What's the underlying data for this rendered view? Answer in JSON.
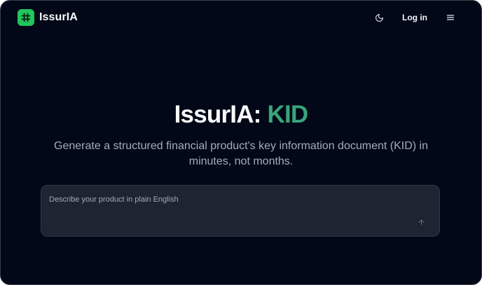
{
  "header": {
    "brand": "IssurIA",
    "login_label": "Log in",
    "theme_toggle_icon": "moon-icon",
    "menu_icon": "menu-icon",
    "logo_icon": "hash-icon"
  },
  "hero": {
    "title_name": "IssurIA:",
    "title_accent": "KID",
    "subtitle": "Generate a structured financial product's key information document (KID) in minutes, not months."
  },
  "prompt": {
    "placeholder": "Describe your product in plain English",
    "value": "",
    "send_icon": "arrow-up-icon"
  },
  "colors": {
    "background": "#020817",
    "accent": "#3aa57a",
    "logo_green": "#22c55e",
    "input_background": "#1e2532"
  }
}
